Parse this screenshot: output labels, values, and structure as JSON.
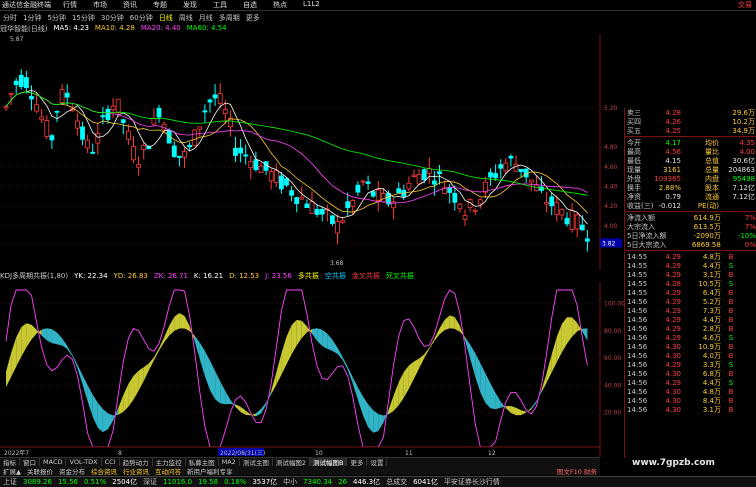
{
  "menubar": {
    "logo": "通达信金融终端",
    "items": [
      "行情",
      "市场",
      "资讯",
      "专题",
      "发现",
      "工具",
      "自选",
      "热点",
      "L1L2"
    ],
    "brand": "交易"
  },
  "periods": [
    {
      "label": "分时",
      "active": false
    },
    {
      "label": "1分钟",
      "active": false
    },
    {
      "label": "5分钟",
      "active": false
    },
    {
      "label": "15分钟",
      "active": false
    },
    {
      "label": "30分钟",
      "active": false
    },
    {
      "label": "60分钟",
      "active": false
    },
    {
      "label": "日线",
      "active": true
    },
    {
      "label": "周线",
      "active": false
    },
    {
      "label": "月线",
      "active": false
    },
    {
      "label": "多周期",
      "active": false
    },
    {
      "label": "更多",
      "active": false
    }
  ],
  "ma_legend": {
    "name": "冠华智能(日线)",
    "ma5": "MA5: 4.23",
    "ma10": "MA10: 4.28",
    "ma20": "MA20: 4.40",
    "ma60": "MA60: 4.54",
    "colors": {
      "name": "#c8c8c8",
      "ma5": "#ffffff",
      "ma10": "#ffcc33",
      "ma20": "#ff44ff",
      "ma60": "#00ff00"
    }
  },
  "chart": {
    "high_label": "5.87",
    "low_label": "3.68",
    "right_axis": [
      "5.20",
      "4.80",
      "4.60",
      "4.40",
      "4.20",
      "4.00",
      "3.82"
    ],
    "current_price_tag": "3.82",
    "dates": [
      "2022年7",
      "8",
      "2022/08/31(三)",
      "10",
      "11",
      "12"
    ],
    "kdj_axis": [
      "100.00",
      "80.00",
      "60.00",
      "40.00",
      "20.00"
    ]
  },
  "indicator": {
    "name": "KDJ多周期共振(1,80)",
    "items": [
      {
        "text": "YK: 22.34",
        "color": "#ffffff"
      },
      {
        "text": "YD: 26.83",
        "color": "#ffcc33"
      },
      {
        "text": "ZK: 26.71",
        "color": "#ff44ff"
      },
      {
        "text": "K: 16.21",
        "color": "#ffffff"
      },
      {
        "text": "D: 12.53",
        "color": "#ffcc33"
      },
      {
        "text": "J: 23.56",
        "color": "#ff44ff"
      },
      {
        "text": "多共振",
        "color": "#ffff00"
      },
      {
        "text": "空共振",
        "color": "#00ccff"
      },
      {
        "text": "金叉共振",
        "color": "#ff3b3b"
      },
      {
        "text": "死叉共振",
        "color": "#00ff00"
      }
    ]
  },
  "bottom_tabs": [
    {
      "label": "指标",
      "active": false
    },
    {
      "label": "窗口",
      "active": false
    },
    {
      "label": "MACD",
      "active": false
    },
    {
      "label": "VOL-TDX",
      "active": false
    },
    {
      "label": "CCI",
      "active": false
    },
    {
      "label": "趋势动力",
      "active": false
    },
    {
      "label": "主力监控",
      "active": false
    },
    {
      "label": "私募主图",
      "active": false
    },
    {
      "label": "MA2",
      "active": false
    },
    {
      "label": "测试主图",
      "active": false
    },
    {
      "label": "测试幅图2",
      "active": false
    },
    {
      "label": "测试幅图B",
      "active": true
    },
    {
      "label": "更多",
      "active": false
    },
    {
      "label": "设置",
      "active": false
    }
  ],
  "sub_tabs": {
    "items": [
      {
        "label": "扩展▲",
        "hl": false
      },
      {
        "label": "关联报价",
        "hl": false
      },
      {
        "label": "资金分布",
        "hl": false
      },
      {
        "label": "综合资讯",
        "hl": true
      },
      {
        "label": "行业资讯",
        "hl": true
      },
      {
        "label": "互动问答",
        "hl": true
      },
      {
        "label": "新用户福利专享",
        "hl": false
      }
    ],
    "right": "图文F10 财务"
  },
  "status": [
    {
      "text": "上证",
      "color": "#c8c8c8"
    },
    {
      "text": "3089.26",
      "color": "#00ff00"
    },
    {
      "text": "15.56",
      "color": "#00ff00"
    },
    {
      "text": "0.51%",
      "color": "#00ff00"
    },
    {
      "text": "2504亿",
      "color": "#ffffff"
    },
    {
      "text": "深证",
      "color": "#c8c8c8"
    },
    {
      "text": "11016.0",
      "color": "#00ff00"
    },
    {
      "text": "19.58",
      "color": "#00ff00"
    },
    {
      "text": "0.18%",
      "color": "#00ff00"
    },
    {
      "text": "3537亿",
      "color": "#ffffff"
    },
    {
      "text": "中小",
      "color": "#c8c8c8"
    },
    {
      "text": "7340.34",
      "color": "#00ff00"
    },
    {
      "text": "26",
      "color": "#00ff00"
    },
    {
      "text": "446.3亿",
      "color": "#ffffff"
    },
    {
      "text": "总成交",
      "color": "#c8c8c8"
    },
    {
      "text": "6041亿",
      "color": "#ffffff"
    },
    {
      "text": "平安证券长沙行情",
      "color": "#c8c8c8"
    }
  ],
  "quote": {
    "asks": [
      {
        "label": "卖三",
        "price": "4.28",
        "vol": "29.6万"
      },
      {
        "label": "买四",
        "price": "4.26",
        "vol": "10.2万"
      },
      {
        "label": "买五",
        "price": "4.25",
        "vol": "34.9万"
      }
    ],
    "fields": [
      {
        "l1": "今开",
        "v1": "4.17",
        "c1": "dn",
        "l2": "均价",
        "v2": "4.35",
        "c2": "up"
      },
      {
        "l1": "最高",
        "v1": "4.56",
        "c1": "up",
        "l2": "量比",
        "v2": "4.00",
        "c2": "up"
      },
      {
        "l1": "最低",
        "v1": "4.15",
        "c1": "wh",
        "l2": "总值",
        "v2": "30.6亿",
        "c2": "wh"
      },
      {
        "l1": "现量",
        "v1": "3161",
        "c1": "yl",
        "l2": "总量",
        "v2": "204863",
        "c2": "wh"
      },
      {
        "l1": "外盘",
        "v1": "109365",
        "c1": "up",
        "l2": "内盘",
        "v2": "95498",
        "c2": "dn"
      },
      {
        "l1": "换手",
        "v1": "2.88%",
        "c1": "yl",
        "l2": "股本",
        "v2": "7.12亿",
        "c2": "wh"
      },
      {
        "l1": "净资",
        "v1": "0.79",
        "c1": "wh",
        "l2": "流通",
        "v2": "7.12亿",
        "c2": "wh"
      },
      {
        "l1": "收益(三)",
        "v1": "-0.012",
        "c1": "wh",
        "l2": "PE(动)",
        "v2": "",
        "c2": "wh"
      }
    ],
    "flows": [
      {
        "label": "净流入额",
        "value": "614.9万",
        "pct": "7%",
        "color": "up"
      },
      {
        "label": "大宗流入",
        "value": "613.5万",
        "pct": "7%",
        "color": "up"
      },
      {
        "label": "5日净流入额",
        "value": "-2090万",
        "pct": "-10%",
        "color": "dn"
      },
      {
        "label": "5日大宗流入",
        "value": "6869.58",
        "pct": "0%",
        "color": "up"
      }
    ],
    "ticks": [
      {
        "t": "14:55",
        "p": "4.29",
        "v": "4.8万",
        "d": "B"
      },
      {
        "t": "14:55",
        "p": "4.29",
        "v": "4.4万",
        "d": "S"
      },
      {
        "t": "14:55",
        "p": "4.29",
        "v": "3.1万",
        "d": "B"
      },
      {
        "t": "14:55",
        "p": "4.28",
        "v": "10.5万",
        "d": "S"
      },
      {
        "t": "14:55",
        "p": "4.29",
        "v": "6.4万",
        "d": "B"
      },
      {
        "t": "14:56",
        "p": "4.29",
        "v": "5.2万",
        "d": "B"
      },
      {
        "t": "14:56",
        "p": "4.29",
        "v": "7.3万",
        "d": "B"
      },
      {
        "t": "14:56",
        "p": "4.29",
        "v": "4.4万",
        "d": "B"
      },
      {
        "t": "14:56",
        "p": "4.29",
        "v": "2.8万",
        "d": "B"
      },
      {
        "t": "14:56",
        "p": "4.29",
        "v": "4.6万",
        "d": "S"
      },
      {
        "t": "14:56",
        "p": "4.30",
        "v": "10.9万",
        "d": "B"
      },
      {
        "t": "14:56",
        "p": "4.30",
        "v": "4.0万",
        "d": "B"
      },
      {
        "t": "14:56",
        "p": "4.29",
        "v": "3.3万",
        "d": "S"
      },
      {
        "t": "14:56",
        "p": "4.30",
        "v": "6.8万",
        "d": "B"
      },
      {
        "t": "14:56",
        "p": "4.29",
        "v": "4.4万",
        "d": "S"
      },
      {
        "t": "14:56",
        "p": "4.30",
        "v": "4.8万",
        "d": "B"
      },
      {
        "t": "14:56",
        "p": "4.30",
        "v": "8.4万",
        "d": "B"
      },
      {
        "t": "14:56",
        "p": "4.30",
        "v": "3.1万",
        "d": "B"
      }
    ]
  },
  "watermark": "www.7gpzb.com"
}
